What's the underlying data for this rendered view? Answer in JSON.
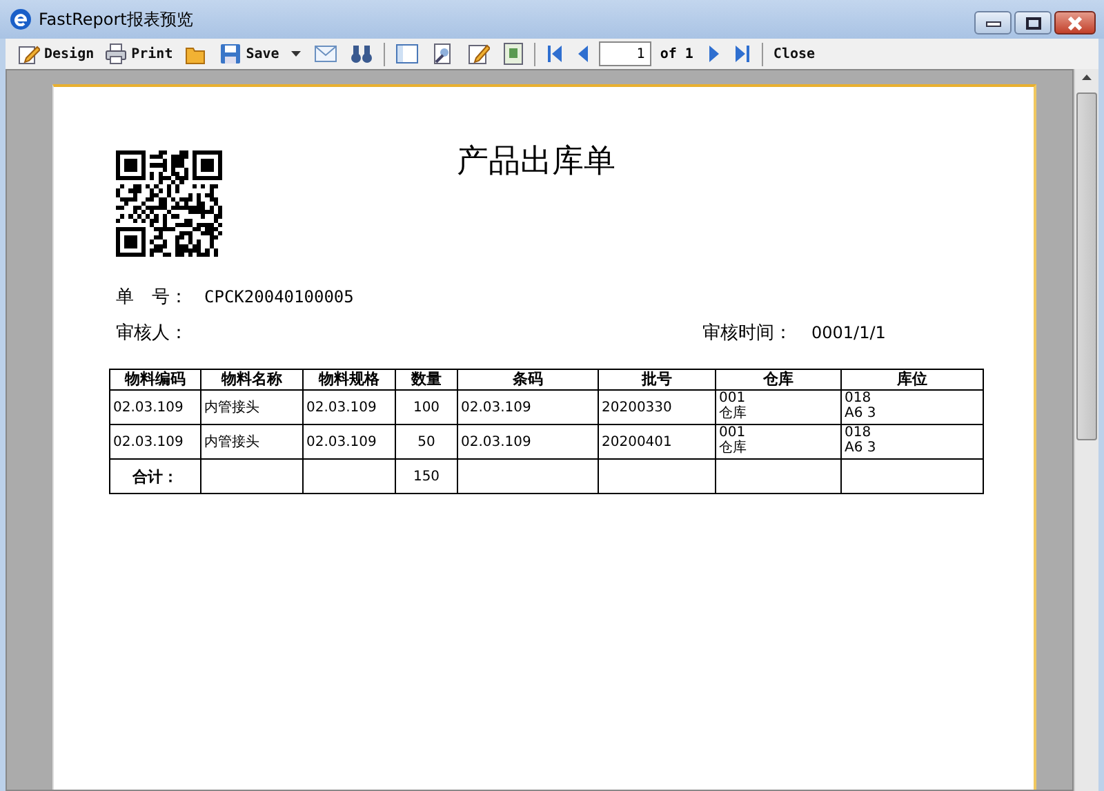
{
  "window": {
    "title": "FastReport报表预览"
  },
  "toolbar": {
    "design": "Design",
    "print": "Print",
    "save": "Save",
    "page_value": "1",
    "page_total": "of 1",
    "close": "Close"
  },
  "report": {
    "title": "产品出库单",
    "order_label": "单　号：",
    "order_value": "CPCK20040100005",
    "reviewer_label": "审核人：",
    "review_time_label": "审核时间：",
    "review_time_value": "0001/1/1",
    "table": {
      "columns": [
        "物料编码",
        "物料名称",
        "物料规格",
        "数量",
        "条码",
        "批号",
        "仓库",
        "库位"
      ],
      "rows": [
        [
          "02.03.109",
          "内管接头",
          "02.03.109",
          "100",
          "02.03.109",
          "20200330",
          "001\n仓库",
          "018\nA6 3"
        ],
        [
          "02.03.109",
          "内管接头",
          "02.03.109",
          "50",
          "02.03.109",
          "20200401",
          "001\n仓库",
          "018\nA6 3"
        ]
      ],
      "total": {
        "label": "合计：",
        "quantity": "150"
      }
    }
  }
}
